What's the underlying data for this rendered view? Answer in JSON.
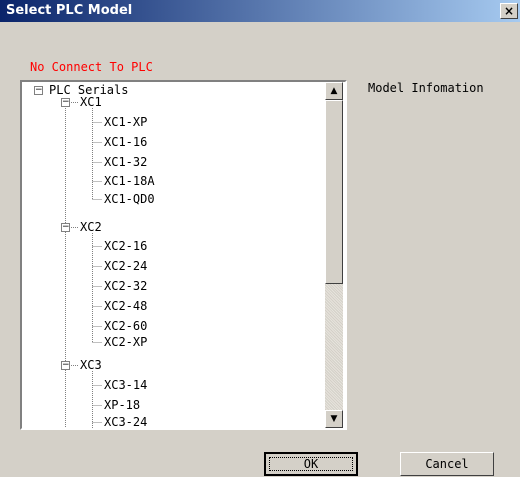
{
  "window": {
    "title": "Select PLC Model",
    "close_glyph": "×"
  },
  "status_text": "No Connect To PLC",
  "tree": {
    "root": {
      "label": "PLC Serials",
      "expander": "−"
    },
    "groups": [
      {
        "label": "XC1",
        "expander": "−",
        "items": [
          "XC1-XP",
          "XC1-16",
          "XC1-32",
          "XC1-18A",
          "XC1-QD0"
        ]
      },
      {
        "label": "XC2",
        "expander": "−",
        "items": [
          "XC2-16",
          "XC2-24",
          "XC2-32",
          "XC2-48",
          "XC2-60",
          "XC2-XP"
        ]
      },
      {
        "label": "XC3",
        "expander": "−",
        "items": [
          "XC3-14",
          "XP-18",
          "XC3-24"
        ]
      }
    ]
  },
  "scrollbar": {
    "up_glyph": "▲",
    "down_glyph": "▼"
  },
  "info_label": "Model Infomation",
  "buttons": {
    "ok": "OK",
    "cancel": "Cancel"
  },
  "colors": {
    "title_bar_start": "#0a246a",
    "title_bar_end": "#a6caf0",
    "status_text": "#ff0000",
    "face": "#d4d0c8"
  }
}
